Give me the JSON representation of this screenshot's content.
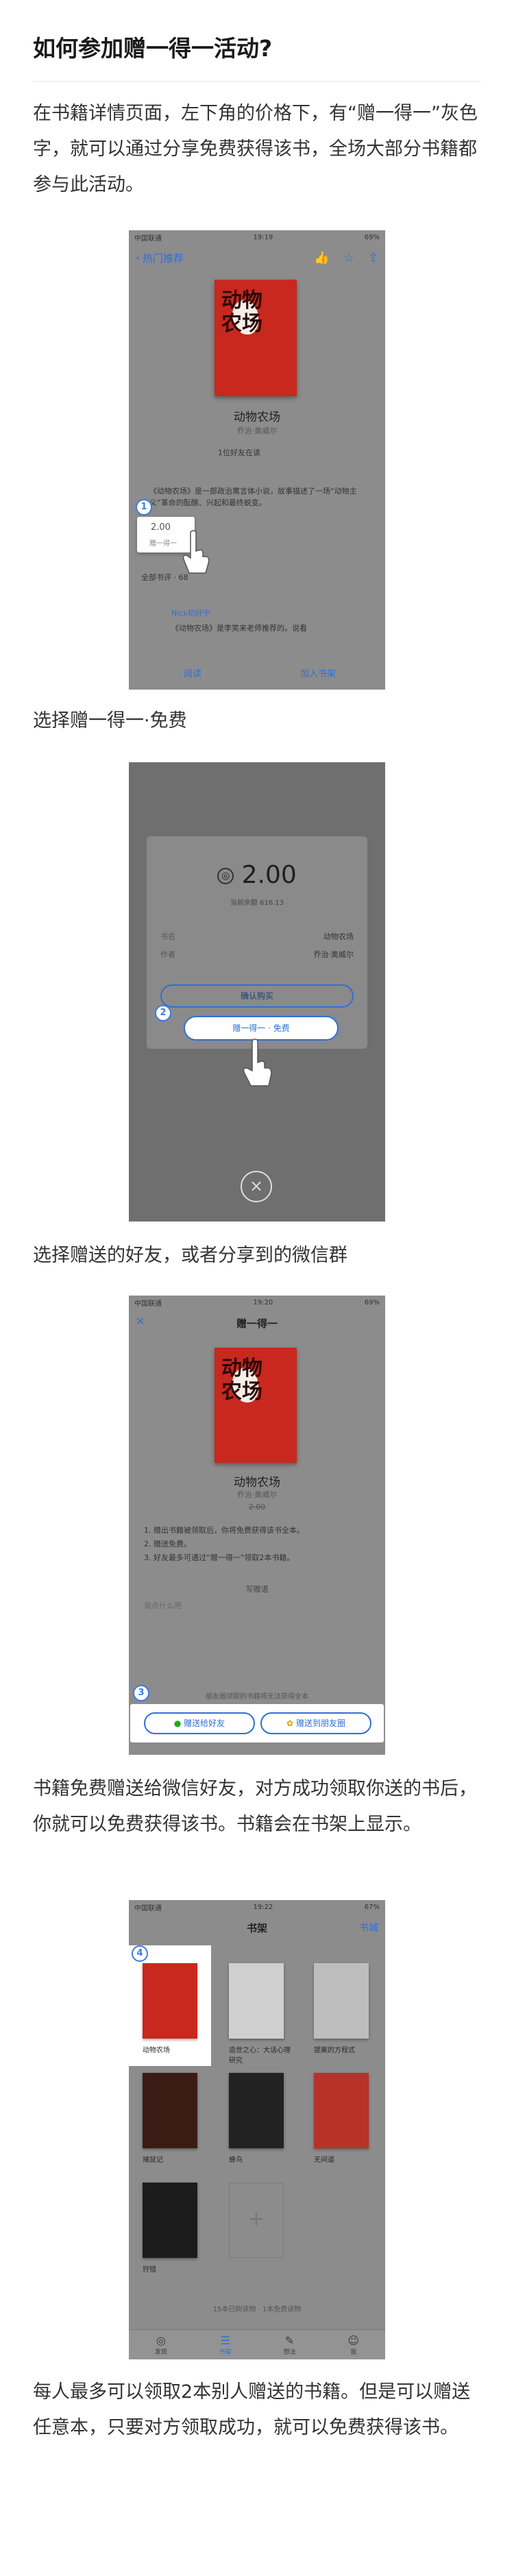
{
  "article": {
    "title": "如何参加赠一得一活动?",
    "paragraphs": [
      "在书籍详情页面，左下角的价格下，有“赠一得一”灰色字，就可以通过分享免费获得该书，全场大部分书籍都参与此活动。",
      "选择赠一得一·免费",
      "选择赠送的好友，或者分享到的微信群",
      "书籍免费赠送给微信好友，对方成功领取你送的书后，你就可以免费获得该书。书籍会在书架上显示。",
      "每人最多可以领取2本别人赠送的书籍。但是可以赠送任意本，只要对方领取成功，就可以免费获得该书。"
    ]
  },
  "shot1": {
    "status_carrier": "中国联通",
    "status_time": "19:19",
    "status_battery": "69%",
    "nav_back": "热门推荐",
    "book_name": "动物农场",
    "book_author": "乔治·奥威尔",
    "reading_friends": "1位好友在读",
    "intro": "《动物农场》是一部政治寓言体小说，故事描述了一场“动物主义”革命的酝酿、兴起和最终蜕变。",
    "price": "2.00",
    "gift_label": "赠一得一",
    "comments_label": "全部书评 · 68",
    "reviewer": "Nick初好宁",
    "review": "《动物农场》是李笑来老师推荐的。说看",
    "bottom_read": "阅读",
    "bottom_shelf": "加入书架",
    "marker": "1"
  },
  "shot2": {
    "price": "2.00",
    "balance": "当前余额 616.13",
    "row1_label": "书名",
    "row1_value": "动物农场",
    "row2_label": "作者",
    "row2_value": "乔治·奥威尔",
    "confirm": "确认购买",
    "gift_option": "赠一得一 · 免费",
    "marker": "2",
    "close": "×"
  },
  "shot3": {
    "status_carrier": "中国联通",
    "status_time": "19:20",
    "status_battery": "69%",
    "close": "✕",
    "nav_title": "赠一得一",
    "book_name": "动物农场",
    "book_author": "乔治·奥威尔",
    "old_price": "2.00",
    "rules": [
      "1. 赠出书籍被领取后，你将免费获得该书全本。",
      "2. 赠送免费。",
      "3. 好友最多可通过“赠一得一”领取2本书籍。"
    ],
    "note_title": "写赠语",
    "note_placeholder": "说点什么吧",
    "share_hint": "朋友圈领取的书籍将无法获得全本",
    "btn_friend": "赠送给好友",
    "btn_moments": "赠送到朋友圈",
    "marker": "3"
  },
  "shot4": {
    "status_carrier": "中国联通",
    "status_time": "19:22",
    "status_battery": "67%",
    "nav_title": "书架",
    "nav_right": "书城",
    "marker": "4",
    "books": [
      {
        "label": "动物农场",
        "color": "#c8281e"
      },
      {
        "label": "造世之心：大话心理研究",
        "color": "#f2f2f2"
      },
      {
        "label": "提案的方程式",
        "color": "#e0e0e0"
      },
      {
        "label": "捕鼠记",
        "color": "#3a1c14"
      },
      {
        "label": "蜂鸟",
        "color": "#222222"
      },
      {
        "label": "无间道",
        "color": "#b8322a"
      },
      {
        "label": "狩猎",
        "color": "#1c1c1c"
      }
    ],
    "footer": "15本已购读物 · 1本免费读物",
    "tabs": [
      "发现",
      "书架",
      "想法",
      "我"
    ]
  },
  "colors": {
    "accent": "#2f6fd6",
    "dim_overlay": "#8c8c8c",
    "book_red": "#c8281e",
    "wechat_green": "#1aad19"
  }
}
